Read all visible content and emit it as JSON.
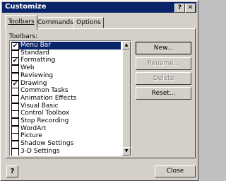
{
  "window": {
    "title": "Customize",
    "help_glyph": "?",
    "close_glyph": "✕"
  },
  "tabs": [
    {
      "label": "Toolbars"
    },
    {
      "label": "Commands"
    },
    {
      "label": "Options"
    }
  ],
  "list": {
    "label": "Toolbars:",
    "items": [
      {
        "label": "Menu Bar",
        "checked": true
      },
      {
        "label": "Standard",
        "checked": false
      },
      {
        "label": "Formatting",
        "checked": true
      },
      {
        "label": "Web",
        "checked": false
      },
      {
        "label": "Reviewing",
        "checked": false
      },
      {
        "label": "Drawing",
        "checked": true
      },
      {
        "label": "Common Tasks",
        "checked": false
      },
      {
        "label": "Animation Effects",
        "checked": false
      },
      {
        "label": "Visual Basic",
        "checked": false
      },
      {
        "label": "Control Toolbox",
        "checked": false
      },
      {
        "label": "Stop Recording",
        "checked": false
      },
      {
        "label": "WordArt",
        "checked": false
      },
      {
        "label": "Picture",
        "checked": false
      },
      {
        "label": "Shadow Settings",
        "checked": false
      },
      {
        "label": "3-D Settings",
        "checked": false
      }
    ]
  },
  "buttons": {
    "new": "New...",
    "rename": "Rename...",
    "delete": "Delete",
    "reset": "Reset...",
    "close": "Close",
    "help": "?"
  },
  "scroll": {
    "up": "▲",
    "down": "▼"
  }
}
